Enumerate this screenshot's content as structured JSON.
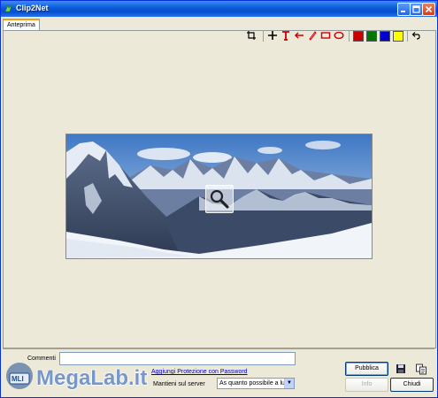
{
  "window": {
    "title": "Clip2Net"
  },
  "tabs": [
    {
      "label": "Anteprima"
    }
  ],
  "toolbar": {
    "tools": [
      "crop-icon",
      "cross-icon",
      "text-icon",
      "arrow-icon",
      "pencil-icon",
      "rectangle-icon",
      "ellipse-icon"
    ],
    "colors": [
      "#cc0000",
      "#007700",
      "#0000cc",
      "#ffff00"
    ],
    "undo_icon": "undo-icon"
  },
  "form": {
    "comments_label": "Commenti",
    "comments_value": "",
    "password_link": "Aggiungi Protezione con Password",
    "server_label": "Mantieni sul server",
    "server_option": "As quanto possibile a lung"
  },
  "buttons": {
    "publish": "Pubblica",
    "info": "Info",
    "close": "Chiudi"
  },
  "watermark": {
    "text": "MegaLab.it"
  }
}
